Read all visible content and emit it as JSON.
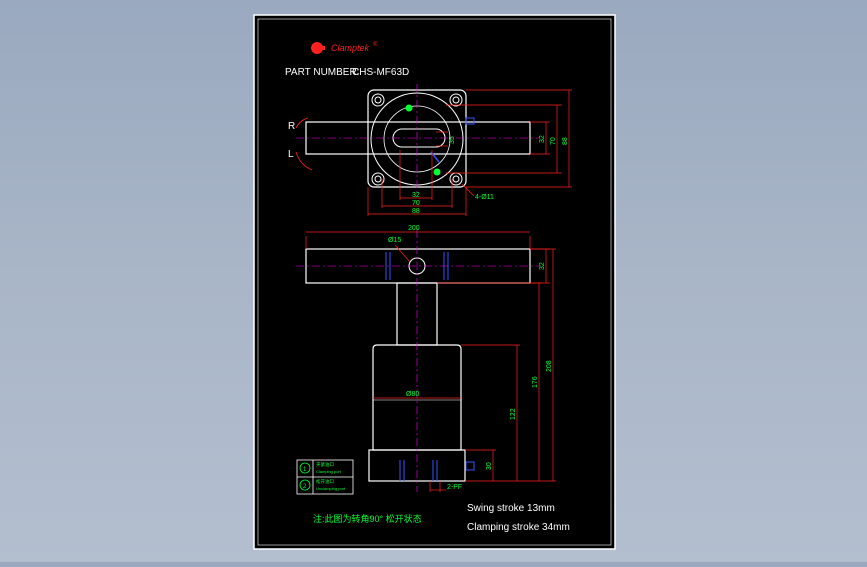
{
  "brand": {
    "name": "Clamptek",
    "mark": "®"
  },
  "part_number": {
    "label": "PART NUMBER:",
    "value": "CHS-MF63D"
  },
  "top_view": {
    "side_labels": [
      "R",
      "L"
    ],
    "dims": {
      "w32": "32",
      "w70": "70",
      "w88": "88",
      "h32": "32",
      "h70": "70",
      "h88": "88",
      "d35": "35",
      "holes": "4-Ø11"
    }
  },
  "front_view": {
    "dims": {
      "arm_len": "200",
      "pin": "Ø15",
      "arm_h": "32",
      "dia": "Ø80",
      "h122": "122",
      "h176": "176",
      "h208": "208",
      "h30": "30",
      "ports": "2-PF"
    }
  },
  "legend": [
    {
      "num": "1",
      "cn": "夹紧油口",
      "en": "Clamping port"
    },
    {
      "num": "2",
      "cn": "松开油口",
      "en": "Unclamping port"
    }
  ],
  "note": "注:此图为转角90° 松开状态",
  "specs": [
    "Swing stroke 13mm",
    "Clamping stroke 34mm"
  ],
  "colors": {
    "drawing_bg": "#000000",
    "line": "#ffffff",
    "dim": "#ff2020",
    "text": "#00ff33",
    "center": "#ff00ff",
    "blue": "#3355ff"
  }
}
